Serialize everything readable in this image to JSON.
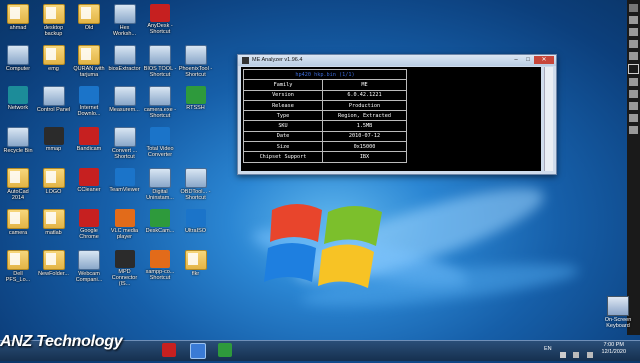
{
  "brand_text": "ANZ Technology",
  "desktop_icons": [
    {
      "label": "ahmad",
      "kind": "folder"
    },
    {
      "label": "desktop backup",
      "kind": "folder"
    },
    {
      "label": "Old",
      "kind": "folder"
    },
    {
      "label": "Hex Worksh...",
      "kind": "app"
    },
    {
      "label": "AnyDesk - Shortcut",
      "kind": "red"
    },
    {
      "label": "Computer",
      "kind": "app"
    },
    {
      "label": "emg",
      "kind": "folder"
    },
    {
      "label": "QURAN with tarjuma",
      "kind": "folder"
    },
    {
      "label": "biosExtractor",
      "kind": "app"
    },
    {
      "label": "BIOS TOOL - Shortcut",
      "kind": "app"
    },
    {
      "label": "PhoenixTool - Shortcut",
      "kind": "app"
    },
    {
      "label": "Network",
      "kind": "teal"
    },
    {
      "label": "Control Panel",
      "kind": "app"
    },
    {
      "label": "Internet Downlo...",
      "kind": "blue"
    },
    {
      "label": "Measurem...",
      "kind": "app"
    },
    {
      "label": "camera.exe - Shortcut",
      "kind": "app"
    },
    {
      "label": "RTSSH",
      "kind": "green"
    },
    {
      "label": "Recycle Bin",
      "kind": "app"
    },
    {
      "label": "mmap",
      "kind": "dark"
    },
    {
      "label": "Bandicam",
      "kind": "red"
    },
    {
      "label": "Convert ... Shortcut",
      "kind": "app"
    },
    {
      "label": "Total Video Converter",
      "kind": "blue"
    },
    {
      "label": "AutoCad 2014",
      "kind": "folder"
    },
    {
      "label": "LOGO",
      "kind": "folder"
    },
    {
      "label": "CCleaner",
      "kind": "red"
    },
    {
      "label": "TeamViewer",
      "kind": "blue"
    },
    {
      "label": "Digital Uninstam...",
      "kind": "app"
    },
    {
      "label": "OBDTool... - Shortcut",
      "kind": "app"
    },
    {
      "label": "camera",
      "kind": "folder"
    },
    {
      "label": "matlab",
      "kind": "folder"
    },
    {
      "label": "Google Chrome",
      "kind": "red"
    },
    {
      "label": "VLC media player",
      "kind": "orange"
    },
    {
      "label": "DeskCam...",
      "kind": "green"
    },
    {
      "label": "UltraISO",
      "kind": "blue"
    },
    {
      "label": "Dell PFS_Lo...",
      "kind": "folder"
    },
    {
      "label": "NewFolder...",
      "kind": "folder"
    },
    {
      "label": "Webcam Compani...",
      "kind": "app"
    },
    {
      "label": "MPD Connector (IS...",
      "kind": "dark"
    },
    {
      "label": "xampp-co... Shortcut",
      "kind": "orange"
    },
    {
      "label": "flkr",
      "kind": "folder"
    }
  ],
  "window": {
    "title": "ME Analyzer v1.96.4",
    "minimize": "–",
    "maximize": "□",
    "close": "✕",
    "header": "hp420 hkp.bin (1/1)",
    "rows": [
      {
        "key": "Family",
        "value": "ME"
      },
      {
        "key": "Version",
        "value": "6.0.42.1221"
      },
      {
        "key": "Release",
        "value": "Production"
      },
      {
        "key": "Type",
        "value": "Region, Extracted"
      },
      {
        "key": "SKU",
        "value": "1.5MB"
      },
      {
        "key": "Date",
        "value": "2010-07-12"
      },
      {
        "key": "Size",
        "value": "0x15000"
      },
      {
        "key": "Chipset Support",
        "value": "IBX"
      }
    ]
  },
  "on_screen_keyboard": "On-Screen Keyboard",
  "taskbar": {
    "language": "EN",
    "time": "7:00 PM",
    "date": "12/1/2020"
  },
  "colors": {
    "console_bg": "#000000",
    "console_header": "#3d6bd8",
    "taskbar": "#16304f"
  }
}
